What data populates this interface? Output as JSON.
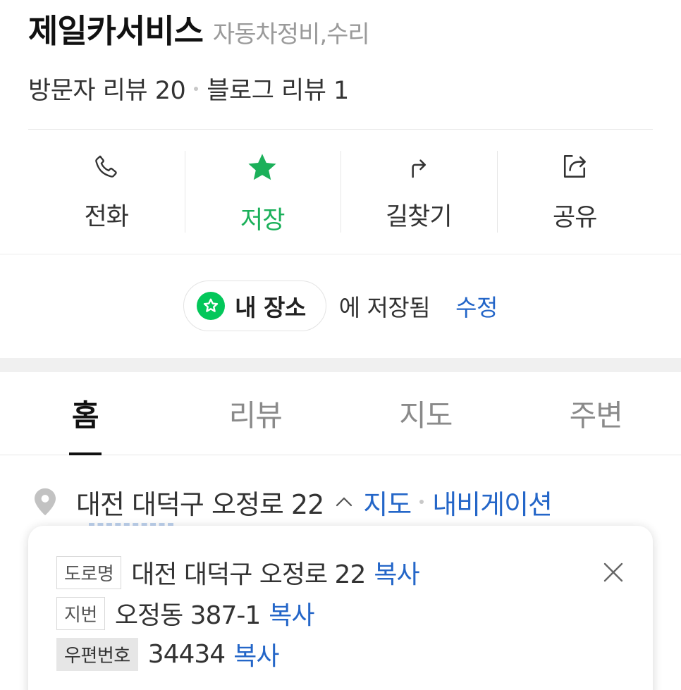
{
  "place": {
    "name": "제일카서비스",
    "category": "자동차정비,수리"
  },
  "reviews": {
    "visitor": "방문자 리뷰 20",
    "blog": "블로그 리뷰 1"
  },
  "actions": [
    {
      "label": "전화",
      "icon": "phone-icon"
    },
    {
      "label": "저장",
      "icon": "star-icon"
    },
    {
      "label": "길찾기",
      "icon": "directions-arrow-icon"
    },
    {
      "label": "공유",
      "icon": "share-icon"
    }
  ],
  "saved": {
    "list_name": "내 장소",
    "suffix": "에 저장됨",
    "edit": "수정"
  },
  "tabs": [
    "홈",
    "리뷰",
    "지도",
    "주변"
  ],
  "address": {
    "main": "대전 대덕구 오정로 22",
    "map_link": "지도",
    "navi_link": "내비게이션"
  },
  "address_detail": {
    "road_tag": "도로명",
    "road_value": "대전 대덕구 오정로 22",
    "jibun_tag": "지번",
    "jibun_value": "오정동 387-1",
    "postal_tag": "우편번호",
    "postal_value": "34434",
    "copy_label": "복사"
  },
  "colors": {
    "accent_green": "#03c75a",
    "link_blue": "#2466c8"
  }
}
